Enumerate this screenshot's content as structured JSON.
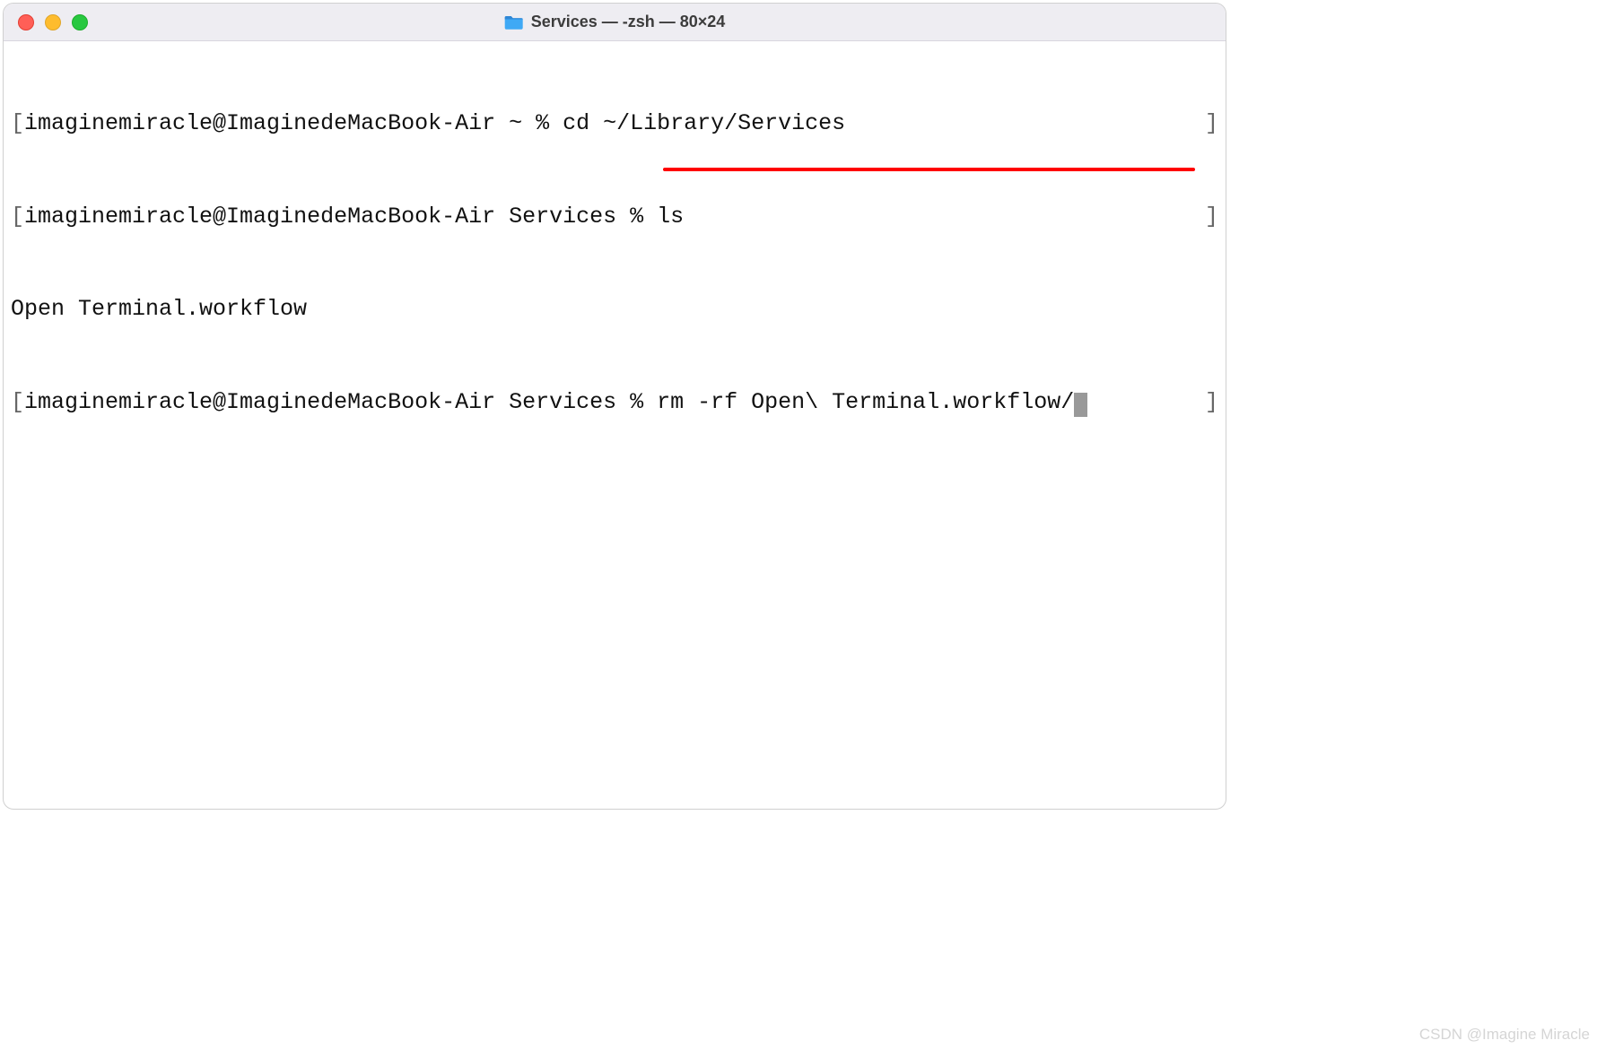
{
  "window": {
    "title": "Services — -zsh — 80×24",
    "folder_icon": "folder-icon"
  },
  "traffic": {
    "close": "close",
    "minimize": "minimize",
    "maximize": "maximize"
  },
  "terminal": {
    "lines": [
      {
        "prompt": "imaginemiracle@ImaginedeMacBook-Air ~ % ",
        "command": "cd ~/Library/Services",
        "has_brackets": true
      },
      {
        "prompt": "imaginemiracle@ImaginedeMacBook-Air Services % ",
        "command": "ls",
        "has_brackets": true
      },
      {
        "output": "Open Terminal.workflow"
      },
      {
        "prompt": "imaginemiracle@ImaginedeMacBook-Air Services % ",
        "command": "rm -rf Open\\ Terminal.workflow/",
        "cursor": true,
        "has_brackets": true
      }
    ],
    "highlighted_command": "rm -rf Open\\ Terminal.workflow/"
  },
  "watermark": "CSDN @Imagine Miracle"
}
